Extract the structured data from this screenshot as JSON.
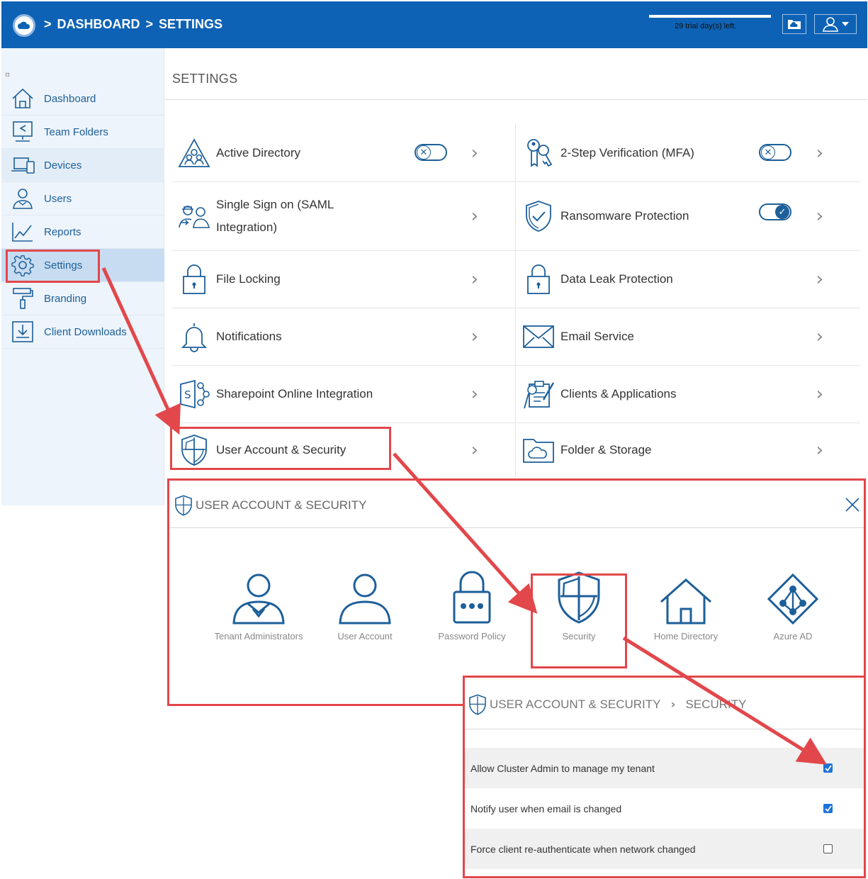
{
  "header": {
    "breadcrumb": [
      ">",
      "DASHBOARD",
      ">",
      "SETTINGS"
    ],
    "trial_text": "29 trial day(s) left."
  },
  "sidebar": {
    "collapse_glyph": "⌑",
    "items": [
      {
        "label": "Dashboard",
        "icon": "home-icon"
      },
      {
        "label": "Team Folders",
        "icon": "team-folders-icon"
      },
      {
        "label": "Devices",
        "icon": "devices-icon"
      },
      {
        "label": "Users",
        "icon": "users-icon"
      },
      {
        "label": "Reports",
        "icon": "reports-icon"
      },
      {
        "label": "Settings",
        "icon": "gear-icon"
      },
      {
        "label": "Branding",
        "icon": "paint-roller-icon"
      },
      {
        "label": "Client Downloads",
        "icon": "download-icon"
      }
    ]
  },
  "settings": {
    "title": "SETTINGS",
    "tiles": [
      {
        "label": "Active Directory",
        "toggle": "off"
      },
      {
        "label": "2-Step Verification (MFA)",
        "toggle": "off"
      },
      {
        "label": "Single Sign on (SAML Integration)"
      },
      {
        "label": "Ransomware Protection",
        "toggle": "on"
      },
      {
        "label": "File Locking"
      },
      {
        "label": "Data Leak Protection"
      },
      {
        "label": "Notifications"
      },
      {
        "label": "Email Service"
      },
      {
        "label": "Sharepoint Online Integration"
      },
      {
        "label": "Clients & Applications"
      },
      {
        "label": "User Account & Security"
      },
      {
        "label": "Folder & Storage"
      }
    ],
    "chevron": "›"
  },
  "user_account_security": {
    "title": "USER ACCOUNT & SECURITY",
    "items": [
      {
        "label": "Tenant Administrators"
      },
      {
        "label": "User Account"
      },
      {
        "label": "Password Policy"
      },
      {
        "label": "Security"
      },
      {
        "label": "Home Directory"
      },
      {
        "label": "Azure AD"
      }
    ]
  },
  "security_panel": {
    "title": "USER ACCOUNT & SECURITY",
    "separator": "›",
    "subtitle": "SECURITY",
    "options": [
      {
        "label": "Allow Cluster Admin to manage my tenant",
        "checked": true
      },
      {
        "label": "Notify user when email is changed",
        "checked": true
      },
      {
        "label": "Force client re-authenticate when network changed",
        "checked": false
      }
    ]
  },
  "colors": {
    "brand": "#0d62b5",
    "highlight": "#e2474b",
    "icon": "#1d5f99"
  }
}
